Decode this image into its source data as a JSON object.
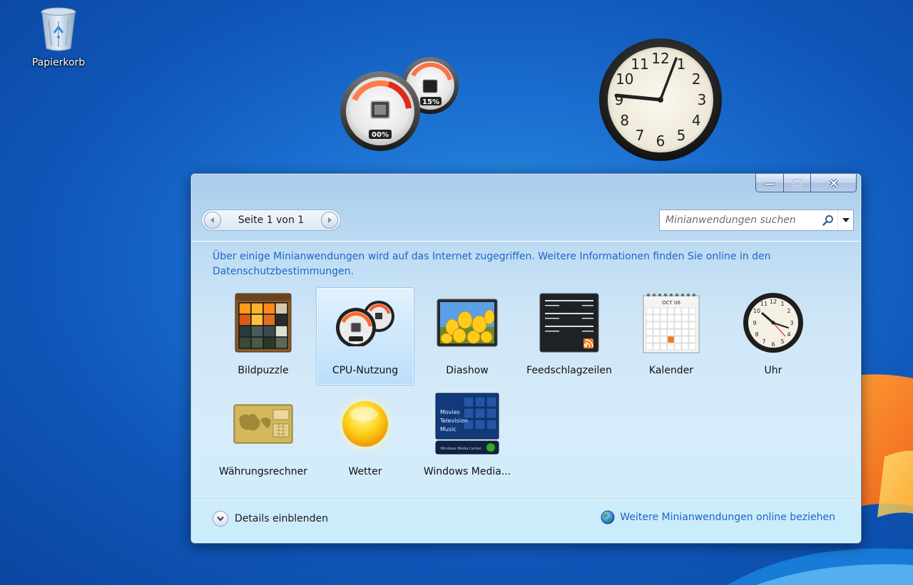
{
  "desktop": {
    "recycle_bin_label": "Papierkorb"
  },
  "gadgets": {
    "cpu_meter": {
      "cpu_percent": "00%",
      "memory_percent": "15%"
    },
    "clock": {
      "numerals": [
        "12",
        "1",
        "2",
        "3",
        "4",
        "5",
        "6",
        "7",
        "8",
        "9",
        "10",
        "11"
      ]
    }
  },
  "gallery": {
    "pager_text": "Seite 1 von 1",
    "search_placeholder": "Minianwendungen suchen",
    "notice": "Über einige Minianwendungen wird auf das Internet zugegriffen. Weitere Informationen finden Sie online in den Datenschutzbestimmungen.",
    "items": [
      {
        "label": "Bildpuzzle",
        "icon": "picture-puzzle-icon"
      },
      {
        "label": "CPU-Nutzung",
        "icon": "cpu-meter-icon",
        "selected": true
      },
      {
        "label": "Diashow",
        "icon": "slideshow-icon"
      },
      {
        "label": "Feedschlagzeilen",
        "icon": "feed-headlines-icon"
      },
      {
        "label": "Kalender",
        "icon": "calendar-icon"
      },
      {
        "label": "Uhr",
        "icon": "clock-icon"
      },
      {
        "label": "Währungsrechner",
        "icon": "currency-icon"
      },
      {
        "label": "Wetter",
        "icon": "weather-sun-icon"
      },
      {
        "label": "Windows Media...",
        "icon": "media-center-icon"
      }
    ],
    "calendar_icon_month": "OCT 06",
    "media_center_menu": [
      "Movies",
      "Television",
      "Music"
    ],
    "media_center_caption": "Windows Media Center",
    "details_label": "Details einblenden",
    "online_link": "Weitere Minianwendungen online beziehen"
  },
  "colors": {
    "link_blue": "#1a67c7",
    "desktop_blue": "#1a6fd0"
  }
}
